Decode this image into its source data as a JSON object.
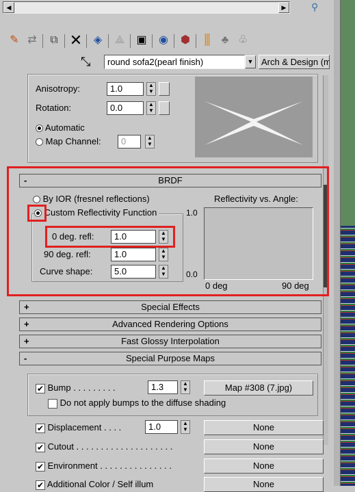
{
  "toolbar": {
    "material_name": "round sofa2(pearl finish)",
    "material_type": "Arch & Design (mi)"
  },
  "anisotropy_section": {
    "anisotropy_label": "Anisotropy:",
    "anisotropy_value": "1.0",
    "rotation_label": "Rotation:",
    "rotation_value": "0.0",
    "automatic_label": "Automatic",
    "map_channel_label": "Map Channel:",
    "map_channel_value": "0"
  },
  "brdf": {
    "title": "BRDF",
    "by_ior_label": "By IOR (fresnel reflections)",
    "custom_label": "Custom Reflectivity Function",
    "deg0_label": "0 deg. refl:",
    "deg0_value": "1.0",
    "deg90_label": "90 deg. refl:",
    "deg90_value": "1.0",
    "curve_label": "Curve shape:",
    "curve_value": "5.0",
    "graph_title": "Reflectivity vs. Angle:",
    "y_max": "1.0",
    "y_min": "0.0",
    "x_min": "0 deg",
    "x_max": "90 deg"
  },
  "rollouts": [
    {
      "sign": "+",
      "label": "Special Effects"
    },
    {
      "sign": "+",
      "label": "Advanced Rendering Options"
    },
    {
      "sign": "+",
      "label": "Fast Glossy Interpolation"
    },
    {
      "sign": "-",
      "label": "Special Purpose Maps"
    }
  ],
  "special_maps": {
    "bump_label": "Bump . . . . . . . . .",
    "bump_value": "1.3",
    "bump_map": "Map #308 (7.jpg)",
    "no_bump_diffuse_label": "Do not apply bumps to the diffuse shading",
    "displacement_label": "Displacement . . . .",
    "displacement_value": "1.0",
    "displacement_map": "None",
    "cutout_label": "Cutout . . . . . . . . . . . . . . . . . . . .",
    "cutout_map": "None",
    "environment_label": "Environment . . . . . . . . . . . . . . .",
    "environment_map": "None",
    "additional_label": "Additional Color / Self illum",
    "additional_map": "None"
  },
  "colors": {
    "highlight": "#e02020",
    "viewport_green": "#5e8a5e"
  }
}
